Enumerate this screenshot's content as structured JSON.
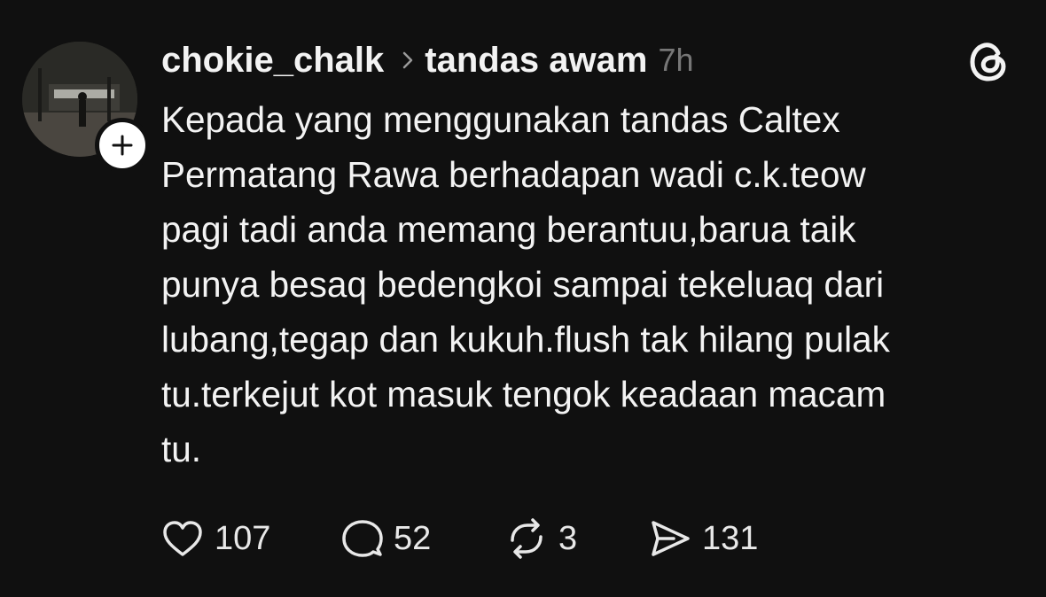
{
  "post": {
    "username": "chokie_chalk",
    "topic": "tandas awam",
    "time": "7h",
    "lines": [
      "Kepada yang menggunakan tandas Caltex",
      "Permatang Rawa berhadapan wadi c.k.teow",
      "pagi tadi anda memang berantuu,barua taik",
      "punya besaq bedengkoi sampai tekeluaq dari",
      "lubang,tegap dan kukuh.flush tak hilang pulak",
      "tu.terkejut kot masuk tengok keadaan macam",
      "tu."
    ]
  },
  "actions": {
    "likes": "107",
    "replies": "52",
    "reposts": "3",
    "shares": "131"
  },
  "icons": {
    "avatar": "avatar-photo",
    "follow": "plus-icon",
    "chevron": "chevron-right-icon",
    "logo": "threads-logo-icon",
    "like": "heart-icon",
    "reply": "comment-bubble-icon",
    "repost": "repost-icon",
    "share": "send-icon"
  },
  "colors": {
    "background": "#101010",
    "text": "#f3f3f3",
    "muted": "#777777"
  }
}
